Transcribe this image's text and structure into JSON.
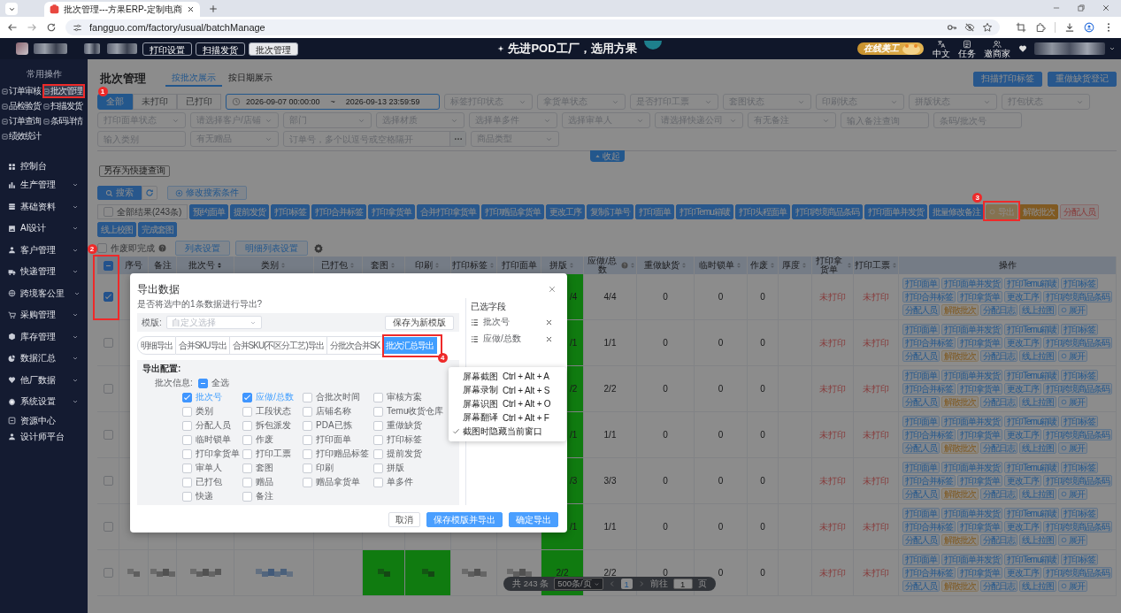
{
  "browser": {
    "tab_title": "批次管理---方果ERP-定制电商",
    "url": "fangguo.com/factory/usual/batchManage"
  },
  "header": {
    "nav_tabs": [
      {
        "label": "打印设置",
        "selected": false
      },
      {
        "label": "扫描发货",
        "selected": false
      },
      {
        "label": "批次管理",
        "selected": true
      }
    ],
    "slogan": "先进POD工厂，选用方果",
    "badge": "在线美工",
    "tools": [
      "中文",
      "任务",
      "邀商家"
    ]
  },
  "sidebar": {
    "section_title": "常用操作",
    "quick_items": [
      {
        "label": "订单审核",
        "selected": false
      },
      {
        "label": "批次管理",
        "selected": true
      },
      {
        "label": "品检验货",
        "selected": false
      },
      {
        "label": "扫描发货",
        "selected": false
      },
      {
        "label": "订单查询",
        "selected": false
      },
      {
        "label": "条码详情",
        "selected": false
      },
      {
        "label": "绩效统计",
        "selected": false
      }
    ],
    "menu": [
      {
        "label": "控制台",
        "expandable": false
      },
      {
        "label": "生产管理",
        "expandable": true
      },
      {
        "label": "基础资料",
        "expandable": true
      },
      {
        "label": "AI设计",
        "expandable": true
      },
      {
        "label": "客户管理",
        "expandable": true
      },
      {
        "label": "快递管理",
        "expandable": true
      },
      {
        "label": "跨境客公里",
        "expandable": true
      },
      {
        "label": "采购管理",
        "expandable": true
      },
      {
        "label": "库存管理",
        "expandable": true
      },
      {
        "label": "数据汇总",
        "expandable": true
      },
      {
        "label": "他厂数据",
        "expandable": true
      },
      {
        "label": "系统设置",
        "expandable": true
      },
      {
        "label": "资源中心",
        "expandable": false
      },
      {
        "label": "设计师平台",
        "expandable": false
      }
    ]
  },
  "page": {
    "title": "批次管理",
    "view_tabs": [
      {
        "label": "按批次展示",
        "selected": true
      },
      {
        "label": "按日期展示",
        "selected": false
      }
    ],
    "top_buttons": [
      "扫描打印标签",
      "重做缺货登记"
    ],
    "print_filter": [
      {
        "label": "全部",
        "selected": true
      },
      {
        "label": "未打印",
        "selected": false
      },
      {
        "label": "已打印",
        "selected": false
      }
    ],
    "date_range": {
      "start": "2026-09-07 00:00:00",
      "separator": "~",
      "end": "2026-09-13 23:59:59"
    },
    "filter_rows": [
      [
        {
          "kind": "select",
          "placeholder": "标签打印状态"
        },
        {
          "kind": "select",
          "placeholder": "拿货单状态"
        },
        {
          "kind": "select",
          "placeholder": "是否打印工票"
        },
        {
          "kind": "select",
          "placeholder": "套图状态"
        },
        {
          "kind": "select",
          "placeholder": "印刷状态"
        },
        {
          "kind": "select",
          "placeholder": "拼版状态"
        },
        {
          "kind": "select",
          "placeholder": "打包状态"
        }
      ],
      [
        {
          "kind": "select",
          "placeholder": "打印面单状态"
        },
        {
          "kind": "select",
          "placeholder": "请选择客户/店铺"
        },
        {
          "kind": "select",
          "placeholder": "部门"
        },
        {
          "kind": "select",
          "placeholder": "选择材质"
        },
        {
          "kind": "select",
          "placeholder": "选择单多件"
        },
        {
          "kind": "select",
          "placeholder": "选择审单人"
        },
        {
          "kind": "select",
          "placeholder": "请选择快递公司"
        },
        {
          "kind": "select",
          "placeholder": "有无备注"
        },
        {
          "kind": "input",
          "placeholder": "输入备注查询"
        },
        {
          "kind": "input",
          "placeholder": "条码/批次号"
        }
      ],
      [
        {
          "kind": "input",
          "placeholder": "输入类别"
        },
        {
          "kind": "select",
          "placeholder": "有无赠品"
        },
        {
          "kind": "more",
          "placeholder": "订单号，多个以逗号或空格隔开"
        },
        {
          "kind": "select",
          "placeholder": "商品类型"
        }
      ]
    ],
    "collapse_label": "收起",
    "save_query_button": "另存为快捷查询",
    "search_button": "搜索",
    "edit_conditions_button": "修改搜索条件",
    "select_all_results": {
      "label": "全部结果(243条)",
      "checked": false
    },
    "action_rows": [
      [
        {
          "label": "预约面单",
          "kind": "primary"
        },
        {
          "label": "提前发货",
          "kind": "primary"
        },
        {
          "label": "打印标签",
          "kind": "primary"
        },
        {
          "label": "打印合并标签",
          "kind": "primary"
        },
        {
          "label": "打印拿货单",
          "kind": "primary"
        },
        {
          "label": "合并打印拿货单",
          "kind": "primary"
        },
        {
          "label": "打印赠品拿货单",
          "kind": "primary"
        },
        {
          "label": "更改工序",
          "kind": "primary"
        },
        {
          "label": "复制订单号",
          "kind": "primary"
        },
        {
          "label": "打印面单",
          "kind": "primary"
        },
        {
          "label": "打印Temu箱唛",
          "kind": "primary"
        },
        {
          "label": "打印头程面单",
          "kind": "primary"
        },
        {
          "label": "打印跨境商品条码",
          "kind": "primary"
        },
        {
          "label": "打印面单并发货",
          "kind": "primary"
        },
        {
          "label": "批量修改备注",
          "kind": "primary"
        },
        {
          "label": "导出",
          "kind": "export"
        },
        {
          "label": "解散批次",
          "kind": "warning"
        },
        {
          "label": "分配人员",
          "kind": "danger"
        }
      ],
      [
        {
          "label": "线上校图",
          "kind": "primary"
        },
        {
          "label": "完成套图",
          "kind": "primary"
        }
      ]
    ],
    "void_done": {
      "label": "作废即完成",
      "checked": false
    },
    "list_settings_buttons": [
      "列表设置",
      "明细列表设置"
    ],
    "table": {
      "select_all": {
        "indeterminate": true
      },
      "columns": [
        {
          "label": "序号",
          "sortable": false
        },
        {
          "label": "备注",
          "sortable": false
        },
        {
          "label": "批次号",
          "sortable": true,
          "sorted": true
        },
        {
          "label": "类别",
          "sortable": true
        },
        {
          "label": "已打包",
          "sortable": true
        },
        {
          "label": "套图",
          "sortable": true
        },
        {
          "label": "印刷",
          "sortable": true
        },
        {
          "label": "打印标签",
          "sortable": true
        },
        {
          "label": "打印面单",
          "sortable": false
        },
        {
          "label": "拼版",
          "sortable": true
        },
        {
          "label": "应做/总数",
          "sortable": true,
          "help": true
        },
        {
          "label": "重做缺货",
          "sortable": true
        },
        {
          "label": "临时锁单",
          "sortable": true
        },
        {
          "label": "作废",
          "sortable": true
        },
        {
          "label": "厚度",
          "sortable": true
        },
        {
          "label": "打印拿货单",
          "sortable": true
        },
        {
          "label": "打印工票",
          "sortable": true
        },
        {
          "label": "操作",
          "sortable": false
        }
      ],
      "rows": [
        {
          "kind": "covered",
          "selected": true,
          "imposition": "/4",
          "imposition_done": true,
          "done_total": "4/4",
          "redo": "0",
          "locked": "0",
          "void": "0",
          "pick_list": "未打印",
          "work_ticket": "未打印",
          "operations": [
            [
              {
                "label": "打印面单",
                "kind": "default"
              },
              {
                "label": "打印面单并发货",
                "kind": "default"
              },
              {
                "label": "打印Temu箱唛",
                "kind": "default"
              },
              {
                "label": "打印标签",
                "kind": "default"
              }
            ],
            [
              {
                "label": "打印合并标签",
                "kind": "default"
              },
              {
                "label": "打印拿货单",
                "kind": "default"
              },
              {
                "label": "更改工序",
                "kind": "default"
              },
              {
                "label": "打印跨境商品条码",
                "kind": "default"
              }
            ],
            [
              {
                "label": "分配人员",
                "kind": "default"
              },
              {
                "label": "解散批次",
                "kind": "warning"
              },
              {
                "label": "分配日志",
                "kind": "default"
              },
              {
                "label": "线上拉图",
                "kind": "default"
              },
              {
                "label": "展开",
                "kind": "expand"
              }
            ]
          ]
        },
        {
          "kind": "covered",
          "selected": false,
          "imposition": "/1",
          "imposition_done": true,
          "done_total": "1/1",
          "redo": "0",
          "locked": "0",
          "void": "0",
          "pick_list": "未打印",
          "work_ticket": "未打印",
          "operations": [
            [
              {
                "label": "打印面单",
                "kind": "default"
              },
              {
                "label": "打印面单并发货",
                "kind": "default"
              },
              {
                "label": "打印Temu箱唛",
                "kind": "default"
              },
              {
                "label": "打印标签",
                "kind": "default"
              }
            ],
            [
              {
                "label": "打印合并标签",
                "kind": "default"
              },
              {
                "label": "打印拿货单",
                "kind": "default"
              },
              {
                "label": "更改工序",
                "kind": "default"
              },
              {
                "label": "打印跨境商品条码",
                "kind": "default"
              }
            ],
            [
              {
                "label": "分配人员",
                "kind": "default"
              },
              {
                "label": "解散批次",
                "kind": "warning"
              },
              {
                "label": "分配日志",
                "kind": "default"
              },
              {
                "label": "线上拉图",
                "kind": "default"
              },
              {
                "label": "展开",
                "kind": "expand"
              }
            ]
          ]
        },
        {
          "kind": "covered",
          "selected": false,
          "imposition": "/2",
          "imposition_done": true,
          "done_total": "2/2",
          "redo": "0",
          "locked": "0",
          "void": "0",
          "pick_list": "未打印",
          "work_ticket": "未打印",
          "operations": [
            [
              {
                "label": "打印面单",
                "kind": "default"
              },
              {
                "label": "打印面单并发货",
                "kind": "default"
              },
              {
                "label": "打印Temu箱唛",
                "kind": "default"
              },
              {
                "label": "打印标签",
                "kind": "default"
              }
            ],
            [
              {
                "label": "打印合并标签",
                "kind": "default"
              },
              {
                "label": "打印拿货单",
                "kind": "default"
              },
              {
                "label": "更改工序",
                "kind": "default"
              },
              {
                "label": "打印跨境商品条码",
                "kind": "default"
              }
            ],
            [
              {
                "label": "分配人员",
                "kind": "default"
              },
              {
                "label": "解散批次",
                "kind": "warning"
              },
              {
                "label": "分配日志",
                "kind": "default"
              },
              {
                "label": "线上拉图",
                "kind": "default"
              },
              {
                "label": "展开",
                "kind": "expand"
              }
            ]
          ]
        },
        {
          "kind": "covered",
          "selected": false,
          "imposition": "/1",
          "imposition_done": true,
          "done_total": "1/1",
          "redo": "0",
          "locked": "0",
          "void": "0",
          "pick_list": "未打印",
          "work_ticket": "未打印",
          "operations": [
            [
              {
                "label": "打印面单",
                "kind": "default"
              },
              {
                "label": "打印面单并发货",
                "kind": "default"
              },
              {
                "label": "打印Temu箱唛",
                "kind": "default"
              },
              {
                "label": "打印标签",
                "kind": "default"
              }
            ],
            [
              {
                "label": "打印合并标签",
                "kind": "default"
              },
              {
                "label": "打印拿货单",
                "kind": "default"
              },
              {
                "label": "更改工序",
                "kind": "default"
              },
              {
                "label": "打印跨境商品条码",
                "kind": "default"
              }
            ],
            [
              {
                "label": "分配人员",
                "kind": "default"
              },
              {
                "label": "解散批次",
                "kind": "warning"
              },
              {
                "label": "分配日志",
                "kind": "default"
              },
              {
                "label": "线上拉图",
                "kind": "default"
              },
              {
                "label": "展开",
                "kind": "expand"
              }
            ]
          ]
        },
        {
          "kind": "covered",
          "selected": false,
          "imposition": "/3",
          "imposition_done": true,
          "done_total": "3/3",
          "redo": "0",
          "locked": "0",
          "void": "0",
          "pick_list": "未打印",
          "work_ticket": "未打印",
          "operations": [
            [
              {
                "label": "打印面单",
                "kind": "default"
              },
              {
                "label": "打印面单并发货",
                "kind": "default"
              },
              {
                "label": "打印Temu箱唛",
                "kind": "default"
              },
              {
                "label": "打印标签",
                "kind": "default"
              }
            ],
            [
              {
                "label": "打印合并标签",
                "kind": "default"
              },
              {
                "label": "打印拿货单",
                "kind": "default"
              },
              {
                "label": "更改工序",
                "kind": "default"
              },
              {
                "label": "打印跨境商品条码",
                "kind": "default"
              }
            ],
            [
              {
                "label": "分配人员",
                "kind": "default"
              },
              {
                "label": "解散批次",
                "kind": "warning"
              },
              {
                "label": "分配日志",
                "kind": "default"
              },
              {
                "label": "线上拉图",
                "kind": "default"
              },
              {
                "label": "展开",
                "kind": "expand"
              }
            ]
          ]
        },
        {
          "kind": "covered",
          "selected": false,
          "imposition": "/1",
          "imposition_done": true,
          "done_total": "1/1",
          "redo": "0",
          "locked": "0",
          "void": "0",
          "pick_list": "未打印",
          "work_ticket": "未打印",
          "operations": [
            [
              {
                "label": "打印面单",
                "kind": "default"
              },
              {
                "label": "打印面单并发货",
                "kind": "default"
              },
              {
                "label": "打印Temu箱唛",
                "kind": "default"
              },
              {
                "label": "打印标签",
                "kind": "default"
              }
            ],
            [
              {
                "label": "打印合并标签",
                "kind": "default"
              },
              {
                "label": "打印拿货单",
                "kind": "default"
              },
              {
                "label": "更改工序",
                "kind": "default"
              },
              {
                "label": "打印跨境商品条码",
                "kind": "default"
              }
            ],
            [
              {
                "label": "分配人员",
                "kind": "default"
              },
              {
                "label": "解散批次",
                "kind": "warning"
              },
              {
                "label": "分配日志",
                "kind": "default"
              },
              {
                "label": "线上拉图",
                "kind": "default"
              },
              {
                "label": "展开",
                "kind": "expand"
              }
            ]
          ]
        },
        {
          "kind": "blurred",
          "selected": false,
          "mockup_done": true,
          "printing_done": true,
          "imposition": "2/2",
          "imposition_done": true,
          "done_total": "2/2",
          "redo": "0",
          "locked": "0",
          "void": "0",
          "pick_list": "未打印",
          "work_ticket": "未打印",
          "operations": [
            [
              {
                "label": "打印面单",
                "kind": "default"
              },
              {
                "label": "打印面单并发货",
                "kind": "default"
              },
              {
                "label": "打印Temu箱唛",
                "kind": "default"
              },
              {
                "label": "打印标签",
                "kind": "default"
              }
            ],
            [
              {
                "label": "打印合并标签",
                "kind": "default"
              },
              {
                "label": "打印拿货单",
                "kind": "default"
              },
              {
                "label": "更改工序",
                "kind": "default"
              },
              {
                "label": "打印跨境商品条码",
                "kind": "default"
              }
            ],
            [
              {
                "label": "分配人员",
                "kind": "default"
              },
              {
                "label": "解散批次",
                "kind": "warning"
              },
              {
                "label": "分配日志",
                "kind": "default"
              },
              {
                "label": "线上拉图",
                "kind": "default"
              },
              {
                "label": "展开",
                "kind": "expand"
              }
            ]
          ]
        }
      ]
    },
    "pagination": {
      "total": "共 243 条",
      "page_size": "500条/页",
      "pages": [
        {
          "label": "1",
          "selected": true
        }
      ],
      "goto_label": "前往",
      "goto_value": "1",
      "page_suffix": "页"
    }
  },
  "export_dialog": {
    "title": "导出数据",
    "question": "是否将选中的1条数据进行导出?",
    "template_label": "模版:",
    "template_placeholder": "自定义选择",
    "save_template_button": "保存为新模版",
    "tabs": [
      {
        "label": "明细导出",
        "selected": false
      },
      {
        "label": "合并SKU导出",
        "selected": false
      },
      {
        "label": "合并SKU(不区分工艺)导出",
        "selected": false
      },
      {
        "label": "分批次合并SK",
        "selected": false
      },
      {
        "label": "批次汇总导出",
        "selected": true
      }
    ],
    "config_title": "导出配置:",
    "group_label": "批次信息:",
    "select_all": {
      "label": "全选",
      "indeterminate": true
    },
    "fields": [
      {
        "label": "批次号",
        "checked": true
      },
      {
        "label": "应做/总数",
        "checked": true
      },
      {
        "label": "合批次时间",
        "checked": false
      },
      {
        "label": "审核方案",
        "checked": false
      },
      {
        "label": "类别",
        "checked": false
      },
      {
        "label": "工段状态",
        "checked": false
      },
      {
        "label": "店铺名称",
        "checked": false
      },
      {
        "label": "Temu收货仓库",
        "checked": false
      },
      {
        "label": "分配人员",
        "checked": false
      },
      {
        "label": "拆包派发",
        "checked": false
      },
      {
        "label": "PDA已拣",
        "checked": false
      },
      {
        "label": "重做缺货",
        "checked": false
      },
      {
        "label": "临时锁单",
        "checked": false
      },
      {
        "label": "作废",
        "checked": false
      },
      {
        "label": "打印面单",
        "checked": false
      },
      {
        "label": "打印标签",
        "checked": false
      },
      {
        "label": "打印拿货单",
        "checked": false
      },
      {
        "label": "打印工票",
        "checked": false
      },
      {
        "label": "打印赠品标签",
        "checked": false
      },
      {
        "label": "提前发货",
        "checked": false
      },
      {
        "label": "审单人",
        "checked": false
      },
      {
        "label": "套图",
        "checked": false
      },
      {
        "label": "印刷",
        "checked": false
      },
      {
        "label": "拼版",
        "checked": false
      },
      {
        "label": "已打包",
        "checked": false
      },
      {
        "label": "赠品",
        "checked": false
      },
      {
        "label": "赠品拿货单",
        "checked": false
      },
      {
        "label": "单多件",
        "checked": false
      },
      {
        "label": "快递",
        "checked": false
      },
      {
        "label": "备注",
        "checked": false
      }
    ],
    "selected_title": "已选字段",
    "selected_fields": [
      "批次号",
      "应做/总数"
    ],
    "buttons": [
      {
        "label": "取消",
        "kind": "default"
      },
      {
        "label": "保存模版并导出",
        "kind": "primary"
      },
      {
        "label": "确定导出",
        "kind": "primary"
      }
    ]
  },
  "context_menu": [
    {
      "label": "屏幕截图",
      "shortcut": "Ctrl + Alt + A",
      "checked": false
    },
    {
      "label": "屏幕录制",
      "shortcut": "Ctrl + Alt + S",
      "checked": false
    },
    {
      "label": "屏幕识图",
      "shortcut": "Ctrl + Alt + O",
      "checked": false
    },
    {
      "label": "屏幕翻译",
      "shortcut": "Ctrl + Alt + F",
      "checked": false
    },
    {
      "label": "截图时隐藏当前窗口",
      "checked": true
    }
  ],
  "annotations": [
    {
      "number": "1"
    },
    {
      "number": "2"
    },
    {
      "number": "3"
    },
    {
      "number": "4"
    }
  ]
}
